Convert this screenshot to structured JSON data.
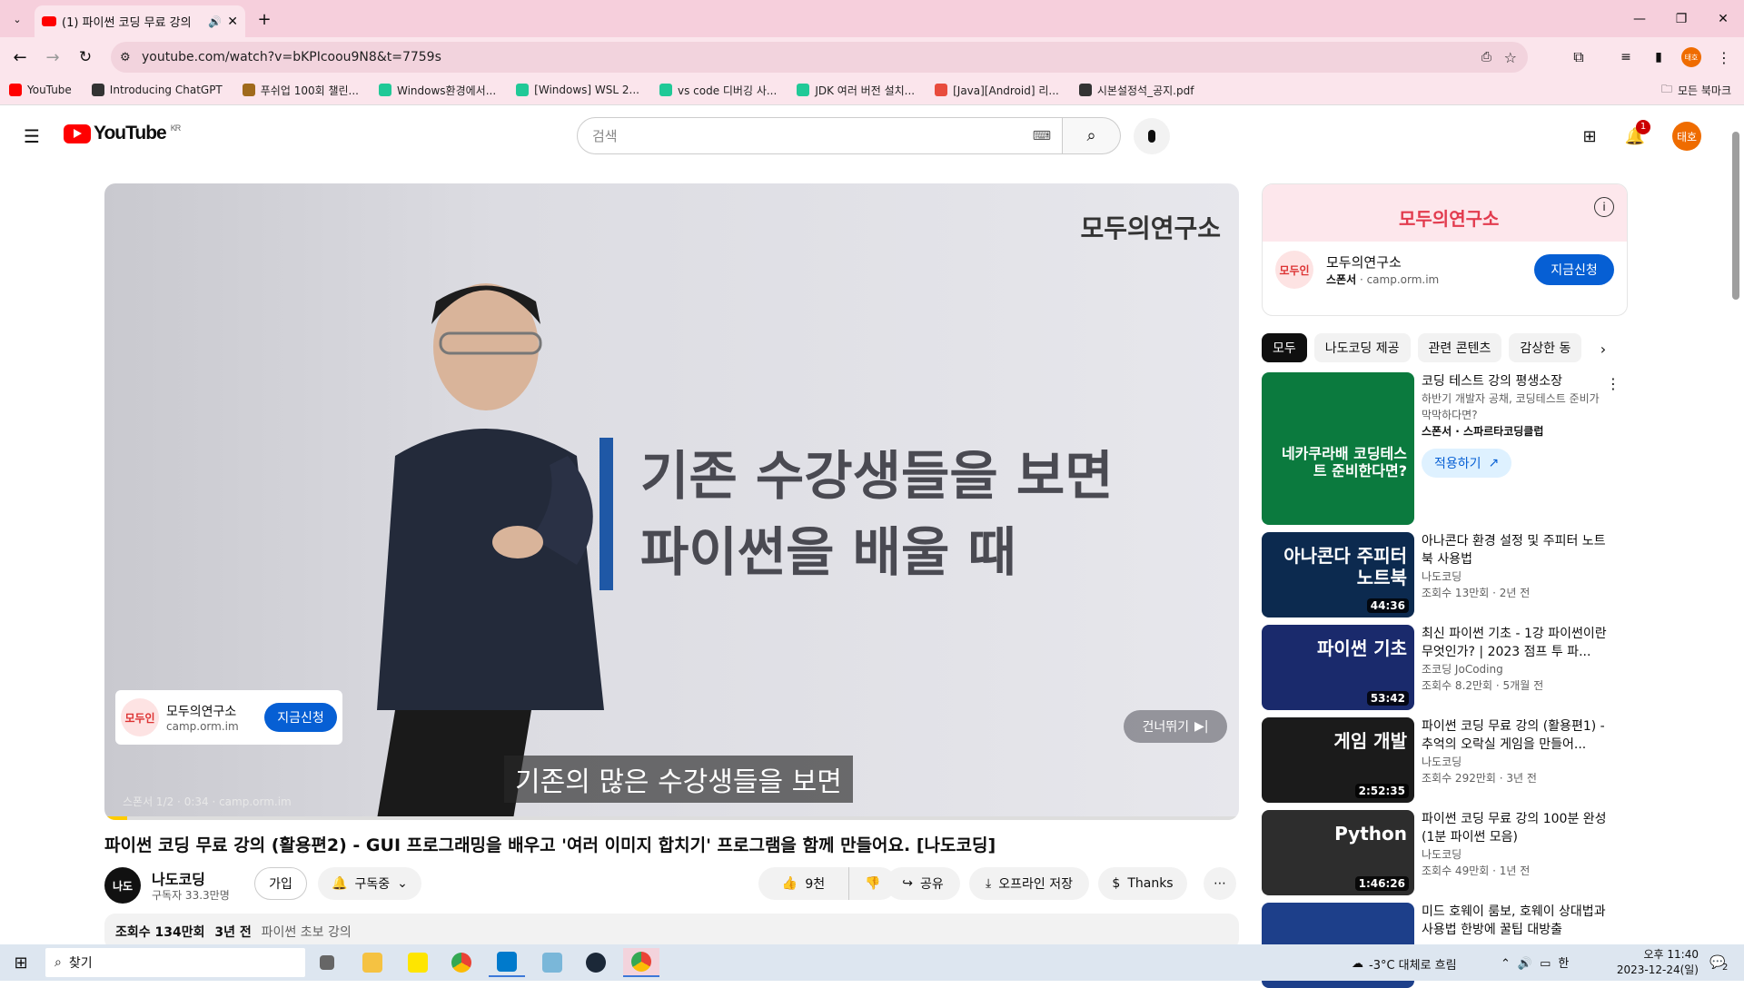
{
  "browser": {
    "tab_title": "(1) 파이썬 코딩 무료 강의",
    "url": "youtube.com/watch?v=bKPIcoou9N8&t=7759s",
    "bookmarks": [
      {
        "label": "YouTube",
        "color": "#f00"
      },
      {
        "label": "Introducing ChatGPT",
        "color": "#333"
      },
      {
        "label": "푸쉬업 100회 챌린...",
        "color": "#a06a1c"
      },
      {
        "label": "Windows환경에서...",
        "color": "#20c997"
      },
      {
        "label": "[Windows] WSL 2...",
        "color": "#20c997"
      },
      {
        "label": "vs code 디버깅 사...",
        "color": "#20c997"
      },
      {
        "label": "JDK 여러 버전 설치...",
        "color": "#20c997"
      },
      {
        "label": "[Java][Android] 리...",
        "color": "#e84c3d"
      },
      {
        "label": "시본설정석_공지.pdf",
        "color": "#333"
      }
    ],
    "all_bookmarks": "모든 북마크"
  },
  "yt": {
    "country": "KR",
    "search_placeholder": "검색",
    "notif_count": "1",
    "avatar": "태호"
  },
  "player": {
    "watermark": "모두의연구소",
    "big_line1": "기존 수강생들을 보면",
    "big_line2": "파이썬을 배울 때",
    "ad_name": "모두의연구소",
    "ad_url": "camp.orm.im",
    "ad_logo": "모두인",
    "ad_btn": "지금신청",
    "skip": "건너뛰기",
    "subtitle": "기존의 많은 수강생들을 보면",
    "ad_info": "스폰서 1/2 · 0:34 · camp.orm.im",
    "progress": 0.02
  },
  "video": {
    "title": "파이썬 코딩 무료 강의 (활용편2) - GUI 프로그래밍을 배우고 '여러 이미지 합치기' 프로그램을 함께 만들어요. [나도코딩]",
    "channel": "나도코딩",
    "subs": "구독자 33.3만명",
    "join": "가입",
    "subscribed": "구독중",
    "likes": "9천",
    "share": "공유",
    "download": "오프라인 저장",
    "thanks": "Thanks",
    "views": "조회수 134만회",
    "age": "3년 전",
    "tag": "파이썬 초보 강의"
  },
  "sponsor": {
    "brand": "모두의연구소",
    "name": "모두의연구소",
    "label": "스폰서",
    "url": "camp.orm.im",
    "btn": "지금신청"
  },
  "chips": [
    "모두",
    "나도코딩 제공",
    "관련 콘텐츠",
    "감상한 동"
  ],
  "recs": [
    {
      "title": "코딩 테스트 강의 평생소장",
      "line1": "하반기 개발자 공채, 코딩테스트 준비가 막막하다면?",
      "line2": "스폰서 · 스파르타코딩클럽",
      "cta": "적용하기",
      "thumb_text": "네카쿠라배 코딩테스트 준비한다면?",
      "bg": "#0b7a3e",
      "duration": ""
    },
    {
      "title": "아나콘다 환경 설정 및 주피터 노트북 사용법",
      "line1": "나도코딩",
      "line2": "조회수 13만회 · 2년 전",
      "thumb_text": "아나콘다 주피터 노트북",
      "bg": "#0c2a4f",
      "duration": "44:36"
    },
    {
      "title": "최신 파이썬 기초 - 1강 파이썬이란 무엇인가? | 2023 점프 투 파...",
      "line1": "조코딩 JoCoding",
      "line2": "조회수 8.2만회 · 5개월 전",
      "thumb_text": "파이썬 기초",
      "bg": "#1a2a6c",
      "duration": "53:42"
    },
    {
      "title": "파이썬 코딩 무료 강의 (활용편1) - 추억의 오락실 게임을 만들어...",
      "line1": "나도코딩",
      "line2": "조회수 292만회 · 3년 전",
      "thumb_text": "게임 개발",
      "bg": "#1b1b1b",
      "duration": "2:52:35"
    },
    {
      "title": "파이썬 코딩 무료 강의 100분 완성 (1분 파이썬 모음)",
      "line1": "나도코딩",
      "line2": "조회수 49만회 · 1년 전",
      "thumb_text": "Python",
      "bg": "#2d2d2d",
      "duration": "1:46:26"
    },
    {
      "title": "미드 호웨이 룸보, 호웨이 상대법과 사용법 한방에 꿀팁 대방출",
      "line1": "",
      "line2": "",
      "thumb_text": "",
      "bg": "#1d3f8a",
      "duration": ""
    }
  ],
  "taskbar": {
    "search": "찾기",
    "weather": "-3°C  대체로 흐림",
    "time": "오후 11:40",
    "date": "2023-12-24(일)",
    "notif": "2"
  }
}
